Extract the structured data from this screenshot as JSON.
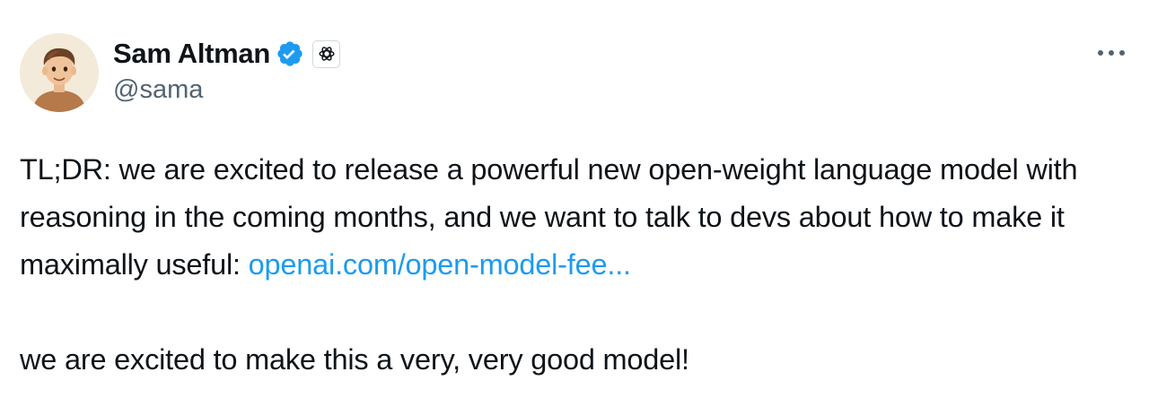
{
  "author": {
    "display_name": "Sam Altman",
    "handle": "@sama",
    "verified_icon": "verified-badge-icon",
    "affiliate_icon": "openai-logo-icon",
    "avatar_icon": "cartoon-avatar"
  },
  "menu": {
    "more_icon": "more-horizontal-icon"
  },
  "tweet": {
    "text_line1_before": "TL;DR: we are excited to release a powerful new open-weight language model with reasoning in the coming months, and we want to talk to devs about how to make it maximally useful: ",
    "link_text": "openai.com/open-model-fee...",
    "text_line2": "we are excited to make this a very, very good model!"
  },
  "colors": {
    "link": "#1d9bf0",
    "verified": "#1d9bf0",
    "secondary_text": "#536471"
  }
}
